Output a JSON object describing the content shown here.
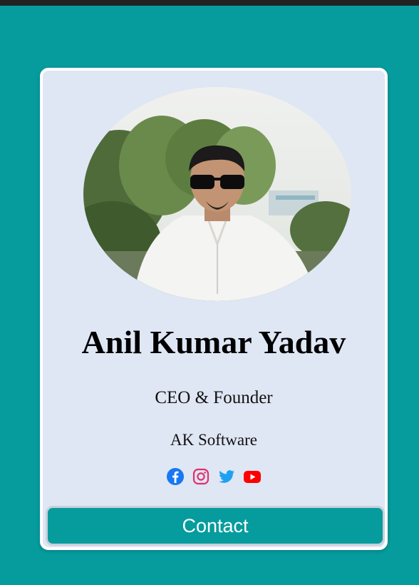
{
  "profile": {
    "name": "Anil Kumar Yadav",
    "role": "CEO & Founder",
    "company": "AK Software",
    "photo_alt": "Profile photo"
  },
  "socials": [
    {
      "icon": "facebook-icon",
      "color": "#1877f2"
    },
    {
      "icon": "instagram-icon",
      "color": "#e1306c"
    },
    {
      "icon": "twitter-icon",
      "color": "#1da1f2"
    },
    {
      "icon": "youtube-icon",
      "color": "#ff0000"
    }
  ],
  "contact": {
    "label": "Contact"
  },
  "colors": {
    "page_background": "#069c9e",
    "card_background": "#dfe6f4",
    "button_background": "#069c9e"
  }
}
